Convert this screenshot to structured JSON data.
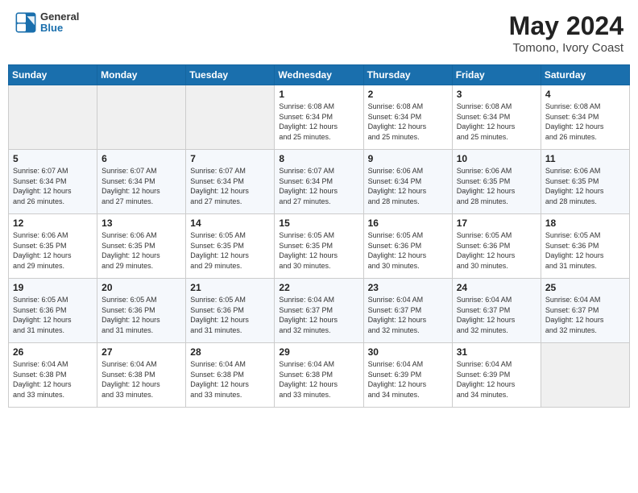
{
  "header": {
    "logo_general": "General",
    "logo_blue": "Blue",
    "title": "May 2024",
    "subtitle": "Tomono, Ivory Coast"
  },
  "weekdays": [
    "Sunday",
    "Monday",
    "Tuesday",
    "Wednesday",
    "Thursday",
    "Friday",
    "Saturday"
  ],
  "weeks": [
    [
      {
        "day": "",
        "info": ""
      },
      {
        "day": "",
        "info": ""
      },
      {
        "day": "",
        "info": ""
      },
      {
        "day": "1",
        "info": "Sunrise: 6:08 AM\nSunset: 6:34 PM\nDaylight: 12 hours\nand 25 minutes."
      },
      {
        "day": "2",
        "info": "Sunrise: 6:08 AM\nSunset: 6:34 PM\nDaylight: 12 hours\nand 25 minutes."
      },
      {
        "day": "3",
        "info": "Sunrise: 6:08 AM\nSunset: 6:34 PM\nDaylight: 12 hours\nand 25 minutes."
      },
      {
        "day": "4",
        "info": "Sunrise: 6:08 AM\nSunset: 6:34 PM\nDaylight: 12 hours\nand 26 minutes."
      }
    ],
    [
      {
        "day": "5",
        "info": "Sunrise: 6:07 AM\nSunset: 6:34 PM\nDaylight: 12 hours\nand 26 minutes."
      },
      {
        "day": "6",
        "info": "Sunrise: 6:07 AM\nSunset: 6:34 PM\nDaylight: 12 hours\nand 27 minutes."
      },
      {
        "day": "7",
        "info": "Sunrise: 6:07 AM\nSunset: 6:34 PM\nDaylight: 12 hours\nand 27 minutes."
      },
      {
        "day": "8",
        "info": "Sunrise: 6:07 AM\nSunset: 6:34 PM\nDaylight: 12 hours\nand 27 minutes."
      },
      {
        "day": "9",
        "info": "Sunrise: 6:06 AM\nSunset: 6:34 PM\nDaylight: 12 hours\nand 28 minutes."
      },
      {
        "day": "10",
        "info": "Sunrise: 6:06 AM\nSunset: 6:35 PM\nDaylight: 12 hours\nand 28 minutes."
      },
      {
        "day": "11",
        "info": "Sunrise: 6:06 AM\nSunset: 6:35 PM\nDaylight: 12 hours\nand 28 minutes."
      }
    ],
    [
      {
        "day": "12",
        "info": "Sunrise: 6:06 AM\nSunset: 6:35 PM\nDaylight: 12 hours\nand 29 minutes."
      },
      {
        "day": "13",
        "info": "Sunrise: 6:06 AM\nSunset: 6:35 PM\nDaylight: 12 hours\nand 29 minutes."
      },
      {
        "day": "14",
        "info": "Sunrise: 6:05 AM\nSunset: 6:35 PM\nDaylight: 12 hours\nand 29 minutes."
      },
      {
        "day": "15",
        "info": "Sunrise: 6:05 AM\nSunset: 6:35 PM\nDaylight: 12 hours\nand 30 minutes."
      },
      {
        "day": "16",
        "info": "Sunrise: 6:05 AM\nSunset: 6:36 PM\nDaylight: 12 hours\nand 30 minutes."
      },
      {
        "day": "17",
        "info": "Sunrise: 6:05 AM\nSunset: 6:36 PM\nDaylight: 12 hours\nand 30 minutes."
      },
      {
        "day": "18",
        "info": "Sunrise: 6:05 AM\nSunset: 6:36 PM\nDaylight: 12 hours\nand 31 minutes."
      }
    ],
    [
      {
        "day": "19",
        "info": "Sunrise: 6:05 AM\nSunset: 6:36 PM\nDaylight: 12 hours\nand 31 minutes."
      },
      {
        "day": "20",
        "info": "Sunrise: 6:05 AM\nSunset: 6:36 PM\nDaylight: 12 hours\nand 31 minutes."
      },
      {
        "day": "21",
        "info": "Sunrise: 6:05 AM\nSunset: 6:36 PM\nDaylight: 12 hours\nand 31 minutes."
      },
      {
        "day": "22",
        "info": "Sunrise: 6:04 AM\nSunset: 6:37 PM\nDaylight: 12 hours\nand 32 minutes."
      },
      {
        "day": "23",
        "info": "Sunrise: 6:04 AM\nSunset: 6:37 PM\nDaylight: 12 hours\nand 32 minutes."
      },
      {
        "day": "24",
        "info": "Sunrise: 6:04 AM\nSunset: 6:37 PM\nDaylight: 12 hours\nand 32 minutes."
      },
      {
        "day": "25",
        "info": "Sunrise: 6:04 AM\nSunset: 6:37 PM\nDaylight: 12 hours\nand 32 minutes."
      }
    ],
    [
      {
        "day": "26",
        "info": "Sunrise: 6:04 AM\nSunset: 6:38 PM\nDaylight: 12 hours\nand 33 minutes."
      },
      {
        "day": "27",
        "info": "Sunrise: 6:04 AM\nSunset: 6:38 PM\nDaylight: 12 hours\nand 33 minutes."
      },
      {
        "day": "28",
        "info": "Sunrise: 6:04 AM\nSunset: 6:38 PM\nDaylight: 12 hours\nand 33 minutes."
      },
      {
        "day": "29",
        "info": "Sunrise: 6:04 AM\nSunset: 6:38 PM\nDaylight: 12 hours\nand 33 minutes."
      },
      {
        "day": "30",
        "info": "Sunrise: 6:04 AM\nSunset: 6:39 PM\nDaylight: 12 hours\nand 34 minutes."
      },
      {
        "day": "31",
        "info": "Sunrise: 6:04 AM\nSunset: 6:39 PM\nDaylight: 12 hours\nand 34 minutes."
      },
      {
        "day": "",
        "info": ""
      }
    ]
  ]
}
